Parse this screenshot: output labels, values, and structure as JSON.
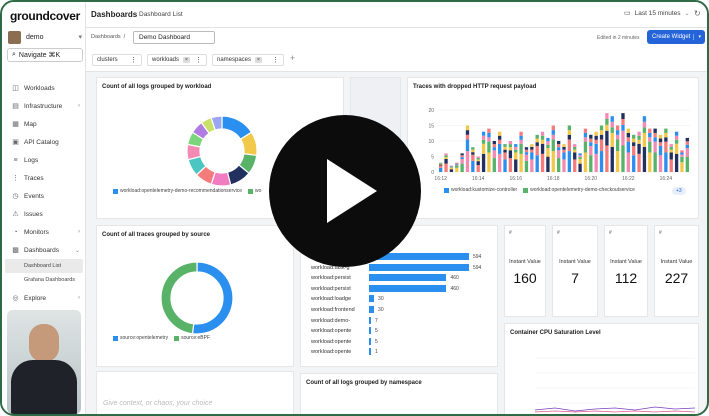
{
  "app": {
    "logo": "groundcover"
  },
  "sidebar": {
    "org": "demo",
    "search": "Navigate ⌘K",
    "items": [
      {
        "label": "Workloads",
        "icon": "cube-icon"
      },
      {
        "label": "Infrastructure",
        "icon": "server-icon",
        "expandable": true
      },
      {
        "label": "Map",
        "icon": "map-icon"
      },
      {
        "label": "API Catalog",
        "icon": "book-icon"
      },
      {
        "label": "Logs",
        "icon": "logs-icon"
      },
      {
        "label": "Traces",
        "icon": "traces-icon"
      },
      {
        "label": "Events",
        "icon": "events-icon"
      },
      {
        "label": "Issues",
        "icon": "issues-icon"
      },
      {
        "label": "Monitors",
        "icon": "bell-icon",
        "expandable": true
      },
      {
        "label": "Dashboards",
        "icon": "grid-icon",
        "expandable": true
      }
    ],
    "sub_items": [
      {
        "label": "Dashboard List",
        "active": true
      },
      {
        "label": "Grafana Dashboards",
        "active": false
      }
    ],
    "explore": {
      "label": "Explore",
      "icon": "compass-icon"
    }
  },
  "topbar": {
    "title": "Dashboards",
    "tab": "Dashboard List",
    "time_range": "Last 15 minutes"
  },
  "toolbar": {
    "breadcrumb_root": "Dashboards",
    "dashboard_name": "Demo Dashboard",
    "edited": "Edited in 2 minutes",
    "create_widget": "Create Widget"
  },
  "filters": [
    {
      "label": "clusters"
    },
    {
      "label": "workloads"
    },
    {
      "label": "namespaces"
    }
  ],
  "widgets": {
    "logs_by_workload": {
      "title": "Count of all logs grouped by workload",
      "legend": [
        "workload:opentelemetry-demo-recommendationservice",
        "wo"
      ]
    },
    "traces_http": {
      "title": "Traces with dropped HTTP request payload",
      "legend": [
        "workload:kustomize-controller",
        "workload:opentelemetry-demo-checkoutservice"
      ],
      "more": "+3"
    },
    "traces_by_source": {
      "title": "Count of all traces grouped by source",
      "legend": [
        "source:opentelemetry",
        "source:eBPF"
      ]
    },
    "hbar": {
      "rows": [
        {
          "label": "",
          "value": 594
        },
        {
          "label": "workload:task-g",
          "value": 594
        },
        {
          "label": "workload:persist",
          "value": 460
        },
        {
          "label": "workload:persist",
          "value": 460
        },
        {
          "label": "workload:loadge",
          "value": 30
        },
        {
          "label": "workload:frontend",
          "value": 30
        },
        {
          "label": "workload:demo-",
          "value": 7
        },
        {
          "label": "workload:opente",
          "value": 5
        },
        {
          "label": "workload:opente",
          "value": 5
        },
        {
          "label": "workload:opente",
          "value": 1
        }
      ]
    },
    "instant_values": [
      {
        "label": "Instant Value",
        "value": "160"
      },
      {
        "label": "Instant Value",
        "value": "7"
      },
      {
        "label": "Instant Value",
        "value": "112"
      },
      {
        "label": "Instant Value",
        "value": "227"
      }
    ],
    "cpu": {
      "title": "Container CPU Saturation Level"
    },
    "logs_by_namespace": {
      "title": "Count of all logs grouped by namespace"
    },
    "text_widget": {
      "placeholder": "Give context, or chaos, your choice"
    }
  },
  "colors": {
    "primary": "#2563d9",
    "bar": "#2b8ff0",
    "green": "#58b368",
    "frame": "#2f6a46"
  },
  "chart_data": [
    {
      "type": "pie",
      "title": "Count of all logs grouped by workload",
      "slices": [
        {
          "value": 16,
          "color": "#2b8ff0"
        },
        {
          "value": 11,
          "color": "#f2c84b"
        },
        {
          "value": 9,
          "color": "#58b368"
        },
        {
          "value": 10,
          "color": "#21305e"
        },
        {
          "value": 9,
          "color": "#f27cc2"
        },
        {
          "value": 8,
          "color": "#f57c7c"
        },
        {
          "value": 8,
          "color": "#4cc6c1"
        },
        {
          "value": 7,
          "color": "#f28ab4"
        },
        {
          "value": 6,
          "color": "#7bd67b"
        },
        {
          "value": 6,
          "color": "#b07be3"
        },
        {
          "value": 5,
          "color": "#c9e06a"
        },
        {
          "value": 5,
          "color": "#9aa6f2"
        }
      ]
    },
    {
      "type": "bar",
      "title": "Traces with dropped HTTP request payload",
      "categories": [
        "16:12",
        "",
        "",
        "",
        "",
        "",
        "",
        "16:14",
        "",
        "",
        "",
        "",
        "",
        "",
        "16:16",
        "",
        "",
        "",
        "",
        "",
        "",
        "16:18",
        "",
        "",
        "",
        "",
        "",
        "",
        "16:20",
        "",
        "",
        "",
        "",
        "",
        "",
        "16:22",
        "",
        "",
        "",
        "",
        "",
        "",
        "16:24",
        "",
        "",
        "",
        ""
      ],
      "totals": [
        3,
        6,
        2,
        3,
        6,
        15,
        8,
        5,
        13,
        14,
        10,
        13,
        9,
        10,
        9,
        13,
        8,
        9,
        12,
        13,
        11,
        15,
        10,
        9,
        15,
        9,
        6,
        14,
        12,
        13,
        15,
        19,
        18,
        15,
        19,
        14,
        12,
        13,
        18,
        14,
        14,
        12,
        14,
        9,
        13,
        7,
        11
      ],
      "ylim": [
        0,
        20
      ],
      "yticks": [
        0,
        5,
        10,
        15,
        20
      ],
      "xticks": [
        "16:12",
        "16:14",
        "16:16",
        "16:18",
        "16:20",
        "16:22",
        "16:24"
      ]
    },
    {
      "type": "pie",
      "title": "Count of all traces grouped by source",
      "slices": [
        {
          "value": 52,
          "color": "#2b8ff0"
        },
        {
          "value": 48,
          "color": "#58b368"
        }
      ]
    }
  ]
}
